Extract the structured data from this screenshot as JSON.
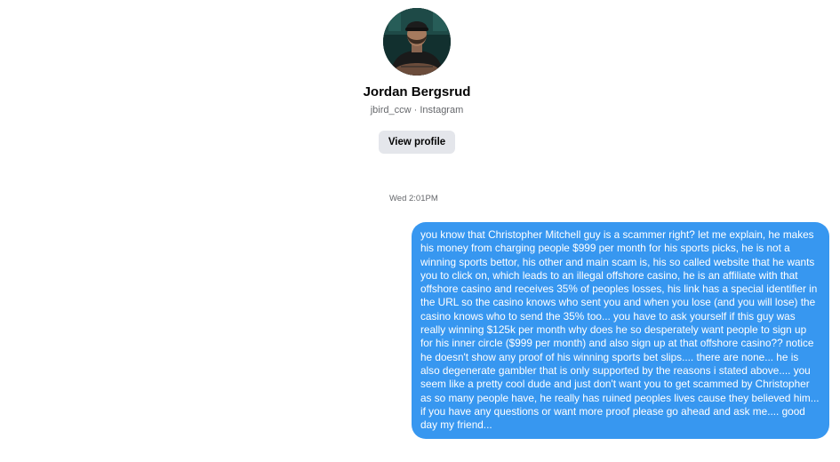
{
  "profile": {
    "name": "Jordan Bergsrud",
    "subtitle": "jbird_ccw · Instagram",
    "view_profile_label": "View profile"
  },
  "conversation": {
    "timestamp": "Wed 2:01PM",
    "messages": [
      {
        "direction": "outgoing",
        "text": "you know that Christopher Mitchell guy is a scammer right? let me explain, he makes his money from charging people $999 per month for his sports picks, he is not a winning sports bettor, his other and main scam is, his so called website that he wants you to click on, which leads to an illegal offshore casino, he is an affiliate with that offshore casino and receives 35% of peoples losses, his link has a special identifier in the URL so the casino knows who sent you and when you lose (and you will lose) the casino knows who to send the 35% too... you have to ask yourself if this guy was really winning $125k per month why does he so desperately want people to sign up for his inner circle ($999 per month) and also sign up at that offshore casino?? notice he doesn't show any proof of his winning sports bet slips.... there are none... he is also degenerate gambler that is only supported by the reasons i stated above.... you seem like a pretty cool dude and just don't want you to get scammed by Christopher as so many people have, he really has ruined peoples lives cause they believed him... if you have any questions or want more proof please go ahead and ask me.... good day my friend..."
      }
    ]
  },
  "colors": {
    "bubble_outgoing": "#3797f0",
    "button_bg": "#e4e6eb",
    "secondary_text": "#65676b"
  }
}
